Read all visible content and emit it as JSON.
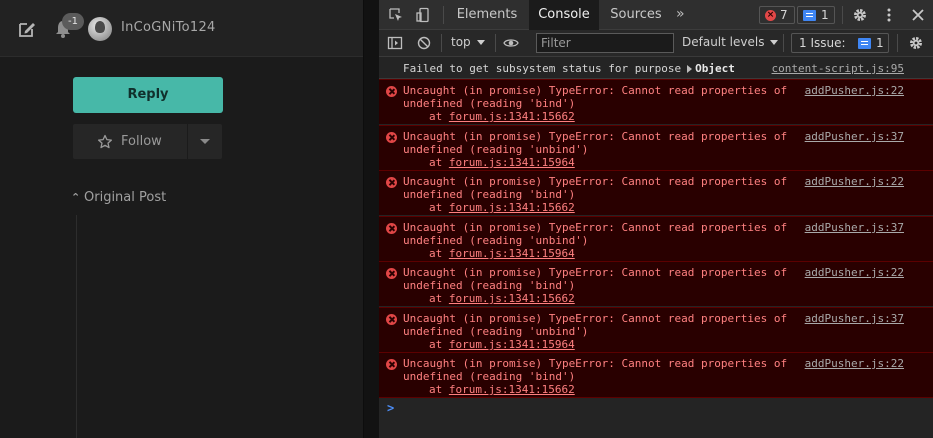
{
  "forum": {
    "notification_badge": "-1",
    "username": "InCoGNiTo124",
    "reply_label": "Reply",
    "follow_label": "Follow",
    "original_post_label": "Original Post"
  },
  "devtools": {
    "tabs": [
      "Elements",
      "Console",
      "Sources"
    ],
    "active_tab": "Console",
    "error_count": "7",
    "message_count": "1",
    "context": "top",
    "filter_placeholder": "Filter",
    "levels": "Default levels",
    "issues_label": "1 Issue:",
    "issues_count": "1",
    "colors": {
      "error_bg": "#290000",
      "error_text": "#ff8080",
      "accent": "#3f86f4",
      "reply_button": "#47b8a8"
    }
  },
  "console": {
    "info": {
      "message": "Failed to get subsystem status for purpose",
      "object": "Object",
      "source": "content-script.js:95"
    },
    "errors": [
      {
        "line1": "Uncaught (in promise) TypeError: Cannot read properties of",
        "line2": "undefined (reading 'bind')",
        "at": "at",
        "location": "forum.js:1341:15662",
        "source": "addPusher.js:22"
      },
      {
        "line1": "Uncaught (in promise) TypeError: Cannot read properties of",
        "line2": "undefined (reading 'unbind')",
        "at": "at",
        "location": "forum.js:1341:15964",
        "source": "addPusher.js:37"
      },
      {
        "line1": "Uncaught (in promise) TypeError: Cannot read properties of",
        "line2": "undefined (reading 'bind')",
        "at": "at",
        "location": "forum.js:1341:15662",
        "source": "addPusher.js:22"
      },
      {
        "line1": "Uncaught (in promise) TypeError: Cannot read properties of",
        "line2": "undefined (reading 'unbind')",
        "at": "at",
        "location": "forum.js:1341:15964",
        "source": "addPusher.js:37"
      },
      {
        "line1": "Uncaught (in promise) TypeError: Cannot read properties of",
        "line2": "undefined (reading 'bind')",
        "at": "at",
        "location": "forum.js:1341:15662",
        "source": "addPusher.js:22"
      },
      {
        "line1": "Uncaught (in promise) TypeError: Cannot read properties of",
        "line2": "undefined (reading 'unbind')",
        "at": "at",
        "location": "forum.js:1341:15964",
        "source": "addPusher.js:37"
      },
      {
        "line1": "Uncaught (in promise) TypeError: Cannot read properties of",
        "line2": "undefined (reading 'bind')",
        "at": "at",
        "location": "forum.js:1341:15662",
        "source": "addPusher.js:22"
      }
    ],
    "prompt": ">"
  }
}
